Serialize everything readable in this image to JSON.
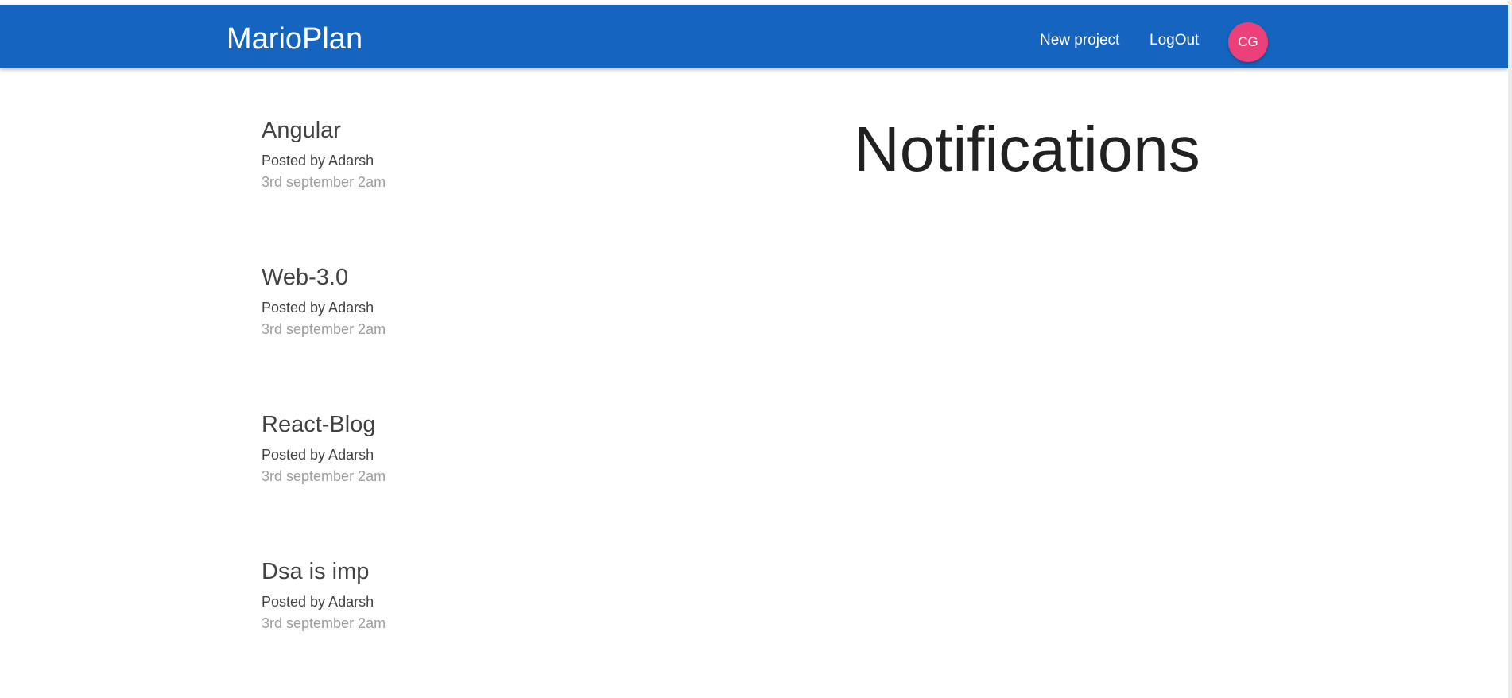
{
  "navbar": {
    "brand": "MarioPlan",
    "links": [
      {
        "label": "New project"
      },
      {
        "label": "LogOut"
      }
    ],
    "avatar_initials": "CG",
    "background_color": "#1565c0",
    "avatar_color": "#ec407a"
  },
  "projects": [
    {
      "title": "Angular",
      "author": "Posted by Adarsh",
      "date": "3rd september 2am"
    },
    {
      "title": "Web-3.0",
      "author": "Posted by Adarsh",
      "date": "3rd september 2am"
    },
    {
      "title": "React-Blog",
      "author": "Posted by Adarsh",
      "date": "3rd september 2am"
    },
    {
      "title": "Dsa is imp",
      "author": "Posted by Adarsh",
      "date": "3rd september 2am"
    }
  ],
  "notifications": {
    "title": "Notifications"
  }
}
